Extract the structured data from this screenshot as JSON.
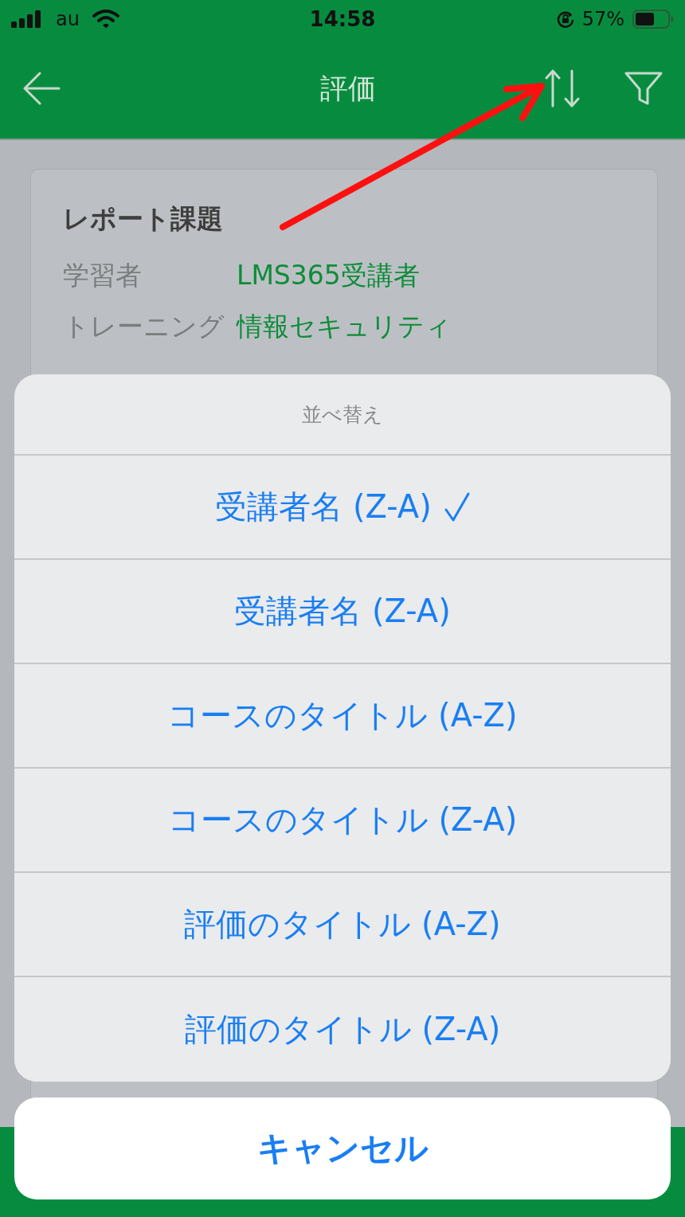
{
  "status_bar": {
    "carrier": "au",
    "time": "14:58",
    "battery": "57%"
  },
  "header": {
    "title": "評価"
  },
  "card": {
    "title": "レポート課題",
    "fields": [
      {
        "label": "学習者",
        "value": "LMS365受講者"
      },
      {
        "label": "トレーニング",
        "value": "情報セキュリティ"
      }
    ]
  },
  "action_sheet": {
    "title": "並べ替え",
    "options": [
      {
        "label": "受講者名 (Z-A)",
        "selected": true
      },
      {
        "label": "受講者名 (Z-A)",
        "selected": false
      },
      {
        "label": "コースのタイトル (A-Z)",
        "selected": false
      },
      {
        "label": "コースのタイトル (Z-A)",
        "selected": false
      },
      {
        "label": "評価のタイトル (A-Z)",
        "selected": false
      },
      {
        "label": "評価のタイトル (Z-A)",
        "selected": false
      }
    ],
    "cancel": "キャンセル"
  }
}
